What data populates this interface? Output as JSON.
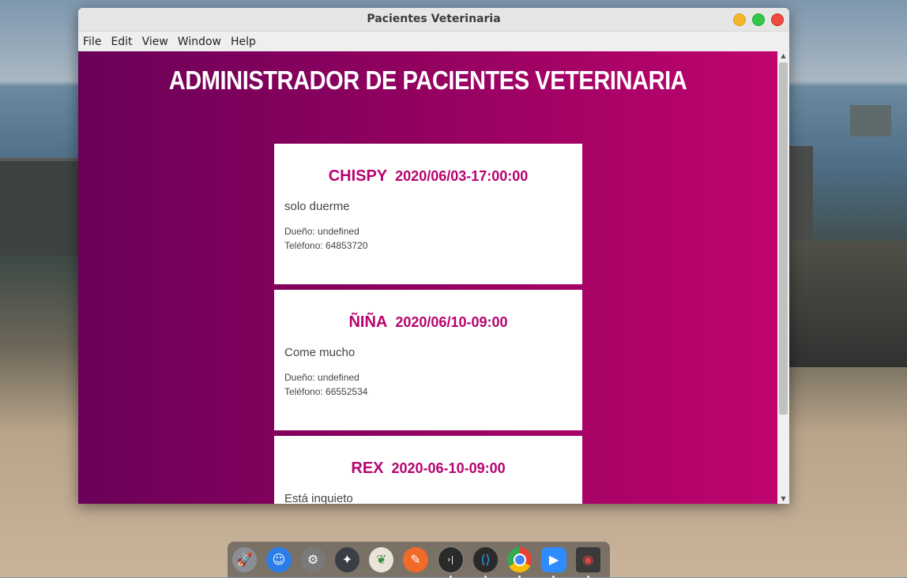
{
  "window": {
    "title": "Pacientes Veterinaria"
  },
  "menu": {
    "file": "File",
    "edit": "Edit",
    "view": "View",
    "window": "Window",
    "help": "Help"
  },
  "app": {
    "heading": "Administrador de Pacientes Veterinaria"
  },
  "patients": [
    {
      "name": "Chispy",
      "datetime": "2020/06/03-17:00:00",
      "symptoms": "solo duerme",
      "owner": "Dueño: undefined",
      "phone": "Teléfono: 64853720"
    },
    {
      "name": "Ñiña",
      "datetime": "2020/06/10-09:00",
      "symptoms": "Come mucho",
      "owner": "Dueño: undefined",
      "phone": "Teléfono: 66552534"
    },
    {
      "name": "Rex",
      "datetime": "2020-06-10-09:00",
      "symptoms": "Está inquieto",
      "owner": "",
      "phone": ""
    }
  ],
  "dock": {
    "apps": [
      {
        "icon": "launchpad-icon",
        "color": "#8a8f96"
      },
      {
        "icon": "finder-icon",
        "color": "#2b7de9"
      },
      {
        "icon": "settings-icon",
        "color": "#7a7a7a"
      },
      {
        "icon": "app-swirl-icon",
        "color": "#3a3f46"
      },
      {
        "icon": "mongodb-icon",
        "color": "#e9e4d8"
      },
      {
        "icon": "postman-icon",
        "color": "#f06a2a"
      },
      {
        "icon": "terminal-icon",
        "color": "#2a2a2a"
      },
      {
        "icon": "vscode-icon",
        "color": "#2a2a2a"
      },
      {
        "icon": "chrome-icon",
        "color": "#e8e8e8"
      },
      {
        "icon": "zoom-icon",
        "color": "#2d8cff"
      },
      {
        "icon": "screenshot-icon",
        "color": "#3a3a3a"
      }
    ]
  },
  "colors": {
    "accent": "#b7036f",
    "gradient_start": "#6a0158",
    "gradient_end": "#c0046e"
  }
}
